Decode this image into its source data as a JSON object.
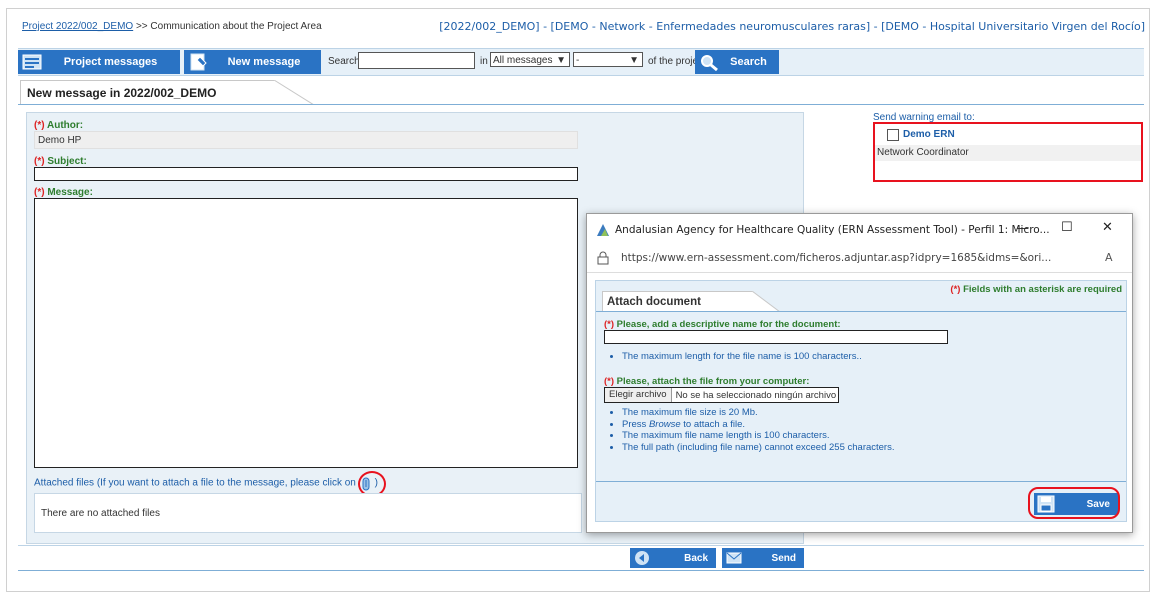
{
  "breadcrumb": {
    "link": "Project 2022/002_DEMO",
    "separator": ">>",
    "current": "Communication about the Project Area"
  },
  "context": "[2022/002_DEMO] - [DEMO - Network - Enfermedades neuromusculares raras] - [DEMO - Hospital Universitario Virgen del Rocío]",
  "toolbar": {
    "project_messages": "Project messages",
    "new_message": "New message",
    "search_label": "Search",
    "in_label": "in",
    "scope_select": "All messages",
    "second_select": "-",
    "of_project": "of the project",
    "search_button": "Search"
  },
  "page_title": "New message in 2022/002_DEMO",
  "form": {
    "required_mark": "(*)",
    "author_label": "Author:",
    "author_value": "Demo HP",
    "subject_label": "Subject:",
    "subject_value": "",
    "message_label": "Message:",
    "message_value": "",
    "attached_label": "Attached files",
    "attached_hint": "(If you want to attach a file to the message, please click on",
    "attached_hint_end": ")",
    "no_files": "There are no attached files",
    "back": "Back",
    "send": "Send"
  },
  "warning": {
    "title": "Send warning email to:",
    "recipient_name": "Demo ERN",
    "recipient_role": "Network Coordinator",
    "checked": false
  },
  "popup": {
    "window_title": "Andalusian Agency for Healthcare Quality (ERN Assessment Tool) - Perfil 1: Micro...",
    "url": "https://www.ern-assessment.com/ficheros.adjuntar.asp?idpry=1685&idms=&ori...",
    "required_note_mark": "(*)",
    "required_note": "Fields with an asterisk are required",
    "tab_title": "Attach document",
    "name_label": "Please, add a descriptive name for the document:",
    "name_value": "",
    "name_hint": "The maximum length for the file name is 100 characters..",
    "file_label": "Please, attach the file from your computer:",
    "choose_button": "Elegir archivo",
    "no_file_text": "No se ha seleccionado ningún archivo",
    "file_hints": [
      {
        "pre": "The maximum file size is 20 Mb.",
        "em": "",
        "post": ""
      },
      {
        "pre": "Press ",
        "em": "Browse",
        "post": " to attach a file."
      },
      {
        "pre": "The maximum file name length is 100 characters.",
        "em": "",
        "post": ""
      },
      {
        "pre": "The full path (including file name) cannot exceed 255 characters.",
        "em": "",
        "post": ""
      }
    ],
    "save": "Save",
    "minimize_glyph": "—",
    "maximize_glyph": "☐",
    "close_glyph": "✕"
  },
  "colors": {
    "toolbar_button": "#2a73c4",
    "highlight": "#e8121e",
    "required_label": "#2e7d2e"
  }
}
